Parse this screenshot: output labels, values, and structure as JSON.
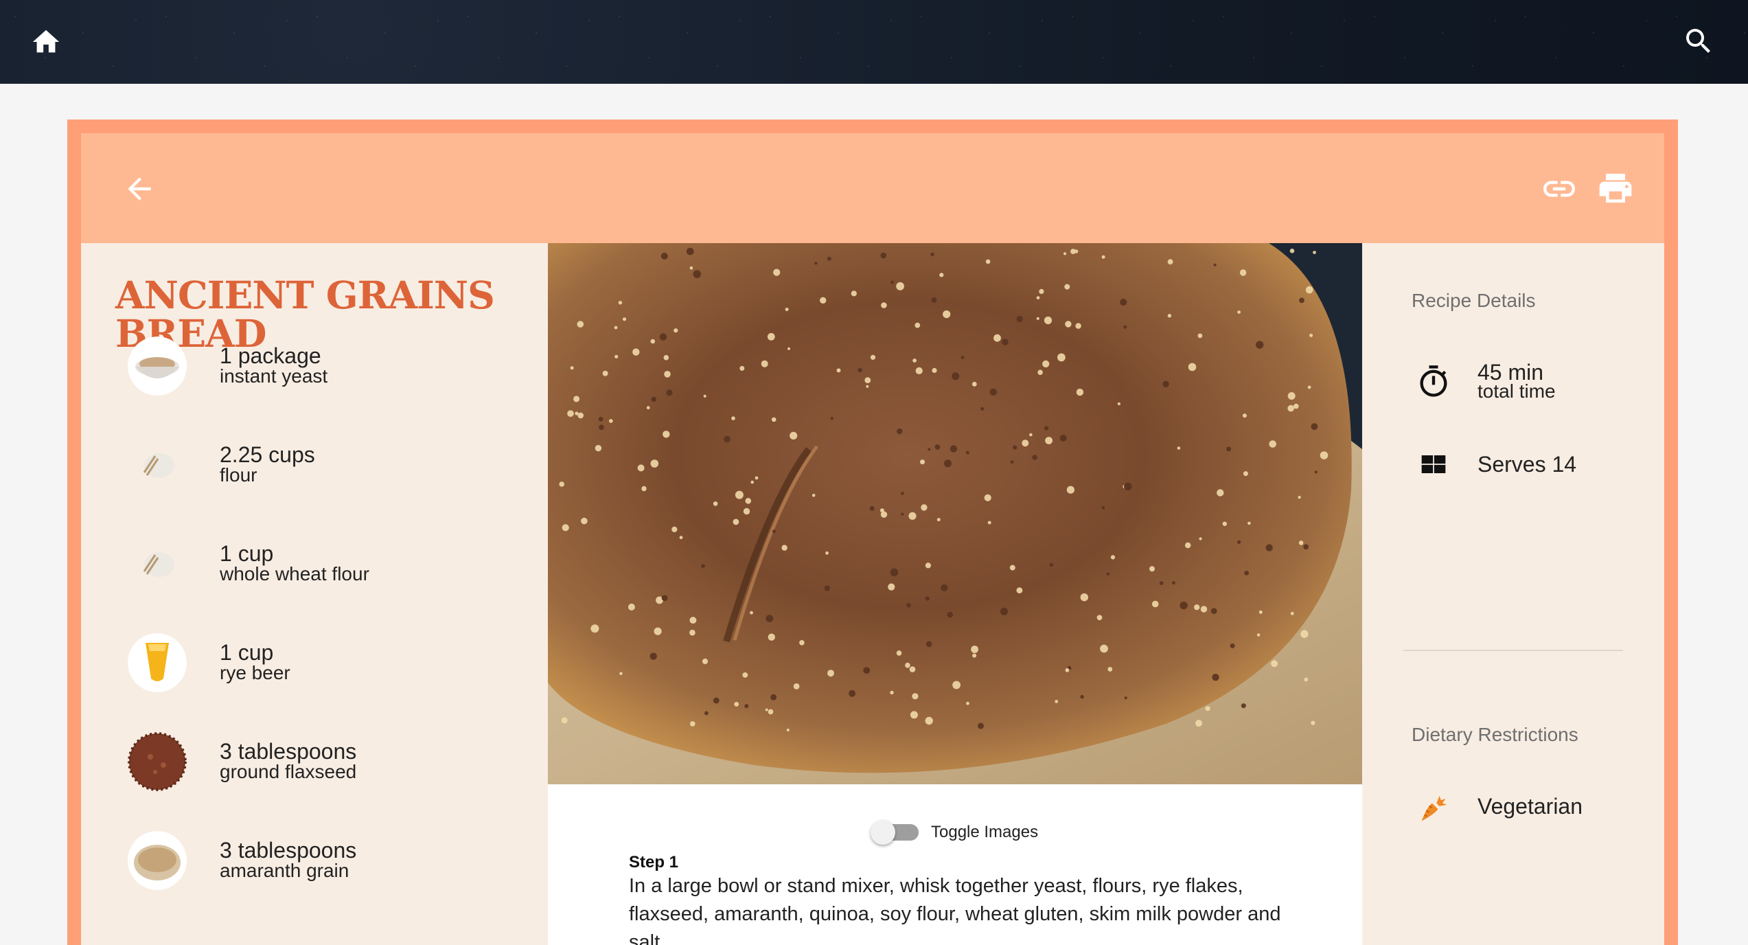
{
  "topbar": {
    "home_icon": "home-icon",
    "search_icon": "search-icon"
  },
  "header": {
    "back_icon": "arrow-back-icon",
    "link_icon": "link-icon",
    "print_icon": "print-icon"
  },
  "recipe": {
    "title": "ANCIENT GRAINS BREAD",
    "ingredients": [
      {
        "amount": "1 package",
        "name": "instant yeast",
        "icon": "yeast-bowl-image"
      },
      {
        "amount": "2.25 cups",
        "name": "flour",
        "icon": "flour-image"
      },
      {
        "amount": "1 cup",
        "name": "whole wheat flour",
        "icon": "flour-image"
      },
      {
        "amount": "1 cup",
        "name": "rye beer",
        "icon": "beer-glass-image"
      },
      {
        "amount": "3 tablespoons",
        "name": "ground flaxseed",
        "icon": "flaxseed-image"
      },
      {
        "amount": "3 tablespoons",
        "name": "amaranth grain",
        "icon": "amaranth-bowl-image"
      }
    ]
  },
  "content": {
    "toggle_label": "Toggle Images",
    "toggle_on": false,
    "step_title": "Step 1",
    "step_text": "In a large bowl or stand mixer, whisk together yeast, flours, rye flakes, flaxseed, amaranth, quinoa, soy flour, wheat gluten, skim milk powder and salt."
  },
  "details": {
    "section_title": "Recipe Details",
    "time_value": "45 min",
    "time_label": "total time",
    "serves": "Serves 14",
    "dietary_title": "Dietary Restrictions",
    "dietary_item": "Vegetarian"
  },
  "colors": {
    "accent": "#dd6438",
    "header": "#ffb992",
    "card_border": "#ff9f78",
    "panel": "#f8ede3"
  }
}
